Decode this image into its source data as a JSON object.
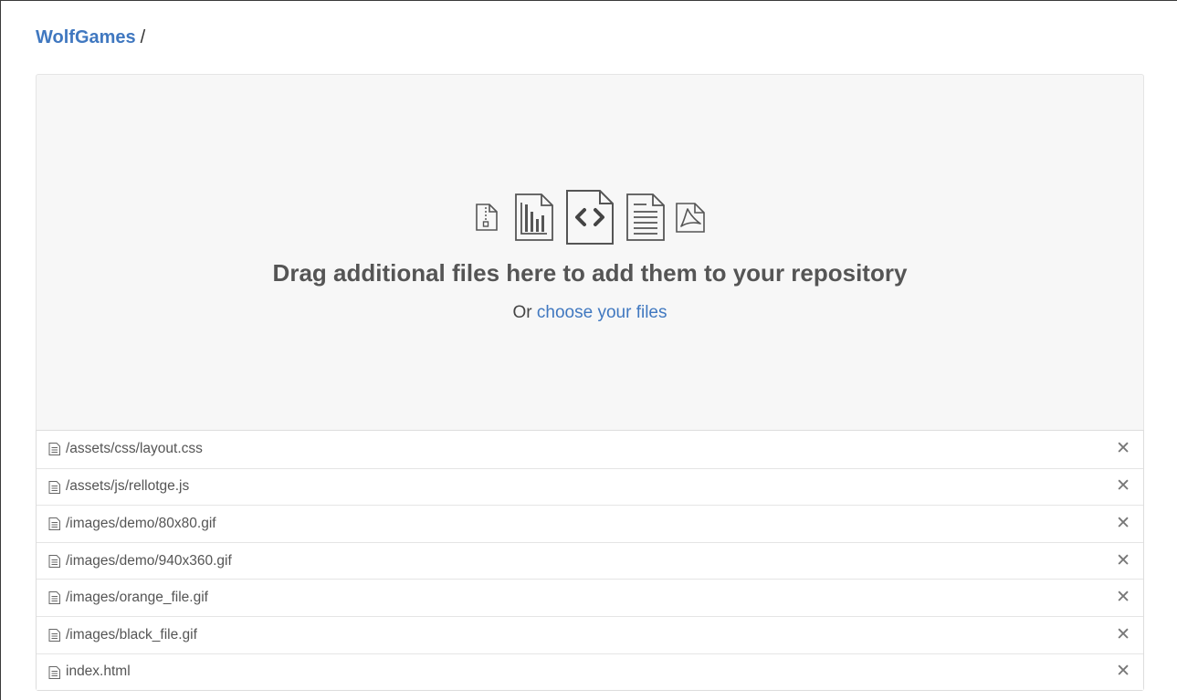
{
  "breadcrumb": {
    "repo": "WolfGames",
    "separator": "/"
  },
  "dropzone": {
    "icons": [
      "zip-file-icon",
      "chart-file-icon",
      "code-file-icon",
      "text-file-icon",
      "pdf-file-icon"
    ],
    "title": "Drag additional files here to add them to your repository",
    "prefix": "Or",
    "choose_link": "choose your files"
  },
  "files": [
    {
      "name": "/assets/css/layout.css",
      "icon": "file-text-icon",
      "remove_label": "✕"
    },
    {
      "name": "/assets/js/rellotge.js",
      "icon": "file-text-icon",
      "remove_label": "✕"
    },
    {
      "name": "/images/demo/80x80.gif",
      "icon": "file-text-icon",
      "remove_label": "✕"
    },
    {
      "name": "/images/demo/940x360.gif",
      "icon": "file-text-icon",
      "remove_label": "✕"
    },
    {
      "name": "/images/orange_file.gif",
      "icon": "file-text-icon",
      "remove_label": "✕"
    },
    {
      "name": "/images/black_file.gif",
      "icon": "file-text-icon",
      "remove_label": "✕"
    },
    {
      "name": "index.html",
      "icon": "file-text-icon",
      "remove_label": "✕"
    }
  ],
  "colors": {
    "link": "#4078c0",
    "dropzone_bg": "#f7f7f7",
    "border": "#e5e5e5"
  }
}
